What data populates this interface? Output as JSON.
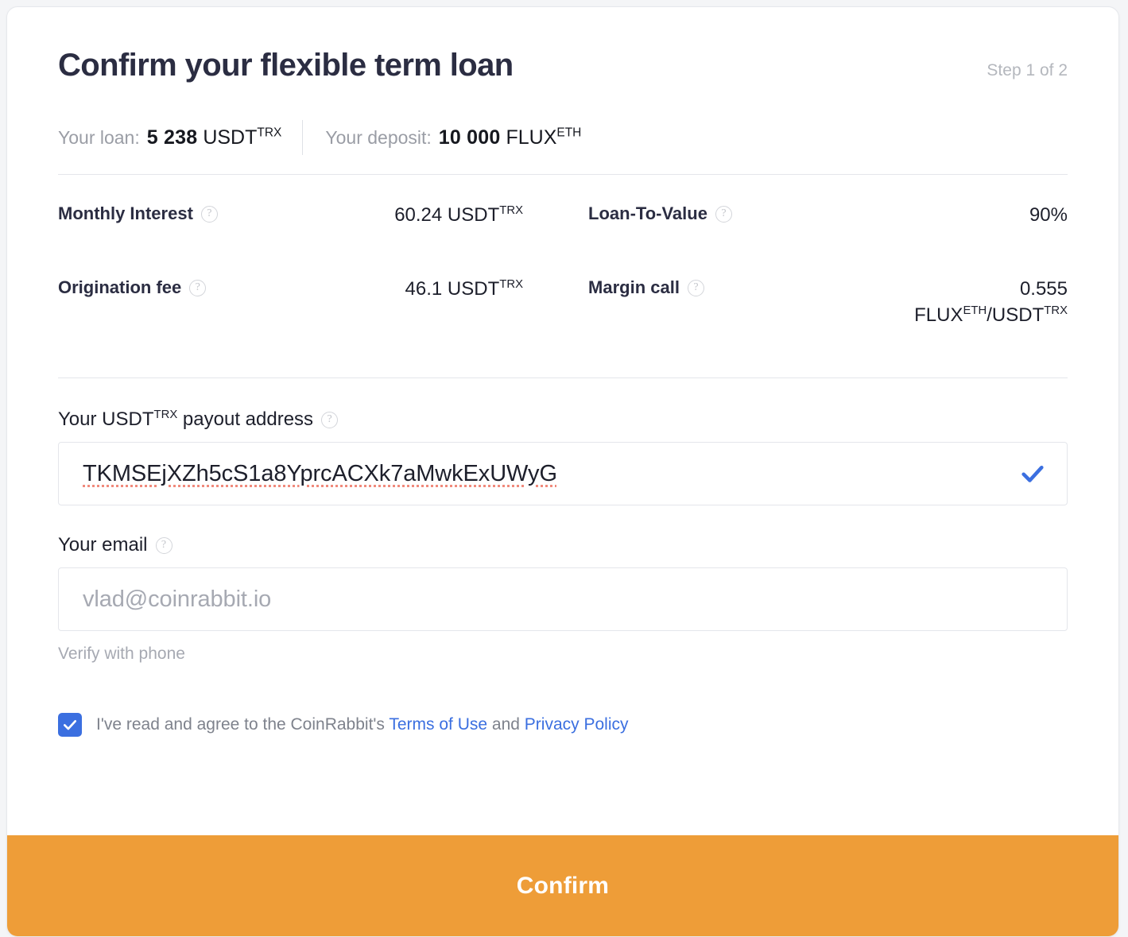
{
  "header": {
    "title": "Confirm your flexible term loan",
    "step": "Step 1 of 2"
  },
  "summary": {
    "loan": {
      "label": "Your loan:",
      "amount": "5 238",
      "ticker": "USDT",
      "network": "TRX"
    },
    "deposit": {
      "label": "Your deposit:",
      "amount": "10 000",
      "ticker": "FLUX",
      "network": "ETH"
    }
  },
  "stats": {
    "monthly_interest": {
      "label": "Monthly Interest",
      "value": "60.24 USDT",
      "value_number": "60.24",
      "value_ticker": "USDT",
      "value_network": "TRX"
    },
    "loan_to_value": {
      "label": "Loan-To-Value",
      "value": "90%"
    },
    "origination_fee": {
      "label": "Origination fee",
      "value_number": "46.1",
      "value_ticker": "USDT",
      "value_network": "TRX"
    },
    "margin_call": {
      "label": "Margin call",
      "value_number": "0.555",
      "pair_base": "FLUX",
      "pair_base_network": "ETH",
      "pair_quote": "USDT",
      "pair_quote_network": "TRX"
    }
  },
  "payout": {
    "label_prefix": "Your ",
    "label_ticker": "USDT",
    "label_network": "TRX",
    "label_suffix": " payout address",
    "value": "TKMSEjXZh5cS1a8YprcACXk7aMwkExUWyG"
  },
  "email": {
    "label": "Your email",
    "placeholder": "vlad@coinrabbit.io",
    "value": "",
    "helper": "Verify with phone"
  },
  "agreement": {
    "text_before": "I've read and agree to the CoinRabbit's ",
    "terms_link": "Terms of Use",
    "text_between": " and ",
    "privacy_link": "Privacy Policy",
    "checked": true
  },
  "footer": {
    "confirm_label": "Confirm"
  },
  "icons": {
    "help": "?",
    "valid_check": "check-icon",
    "checkbox_check": "check-icon"
  },
  "colors": {
    "accent_orange": "#ee9d38",
    "link_blue": "#3b6fe0",
    "title_navy": "#2b2d42",
    "muted_gray": "#a6a9b2",
    "spellcheck_red": "#f08a7c"
  }
}
